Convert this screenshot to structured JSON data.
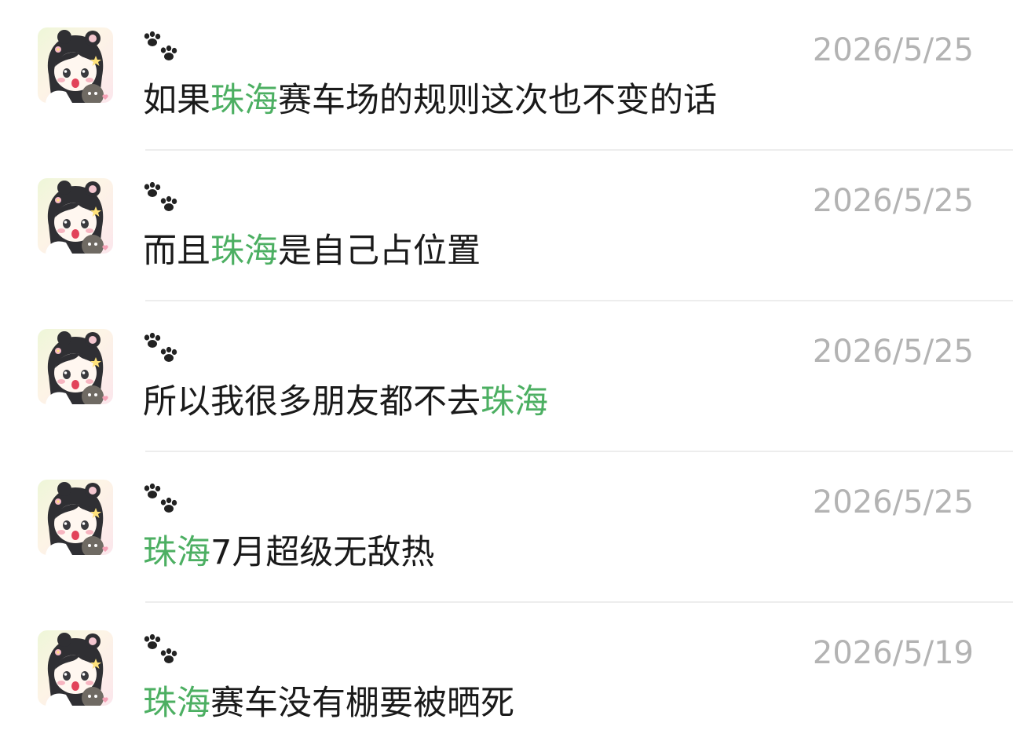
{
  "highlight_color": "#4caf62",
  "comments": [
    {
      "nickname_icon": "paw-prints-icon",
      "date": "2026/5/25",
      "message": [
        {
          "text": "如果",
          "highlight": false
        },
        {
          "text": "珠海",
          "highlight": true
        },
        {
          "text": "赛车场的规则这次也不变的话",
          "highlight": false
        }
      ]
    },
    {
      "nickname_icon": "paw-prints-icon",
      "date": "2026/5/25",
      "message": [
        {
          "text": "而且",
          "highlight": false
        },
        {
          "text": "珠海",
          "highlight": true
        },
        {
          "text": "是自己占位置",
          "highlight": false
        }
      ]
    },
    {
      "nickname_icon": "paw-prints-icon",
      "date": "2026/5/25",
      "message": [
        {
          "text": "所以我很多朋友都不去",
          "highlight": false
        },
        {
          "text": "珠海",
          "highlight": true
        }
      ]
    },
    {
      "nickname_icon": "paw-prints-icon",
      "date": "2026/5/25",
      "message": [
        {
          "text": "珠海",
          "highlight": true
        },
        {
          "text": "7月超级无敌热",
          "highlight": false
        }
      ]
    },
    {
      "nickname_icon": "paw-prints-icon",
      "date": "2026/5/19",
      "message": [
        {
          "text": "珠海",
          "highlight": true
        },
        {
          "text": "赛车没有棚要被晒死",
          "highlight": false
        }
      ]
    }
  ]
}
